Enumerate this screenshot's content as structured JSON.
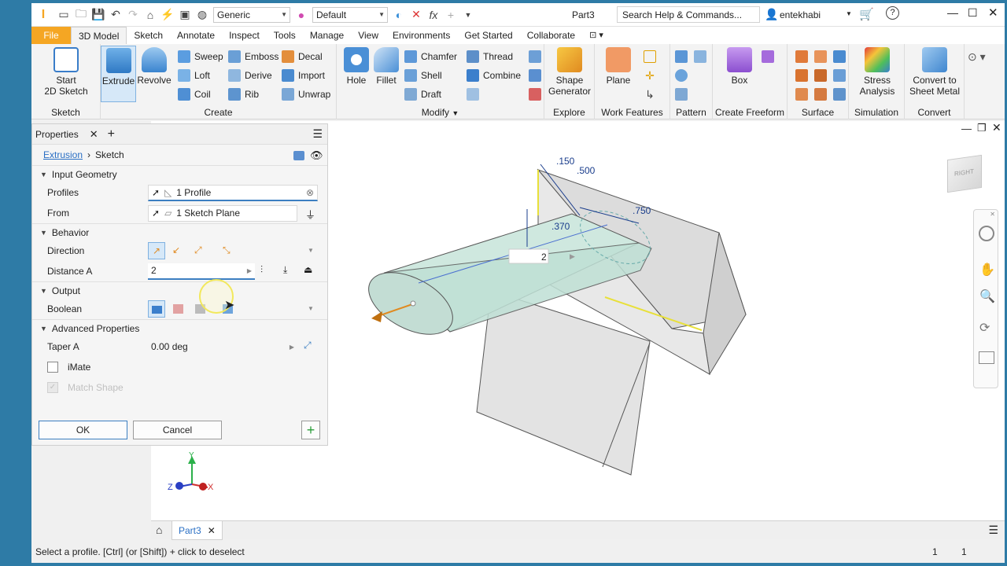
{
  "app": {
    "title": "Part3",
    "appearance": "Generic",
    "material": "Default",
    "search_placeholder": "Search Help & Commands...",
    "user": "entekhabi",
    "accent": "#f5a623"
  },
  "tabs": [
    "File",
    "3D Model",
    "Sketch",
    "Annotate",
    "Inspect",
    "Tools",
    "Manage",
    "View",
    "Environments",
    "Get Started",
    "Collaborate"
  ],
  "ribbon": {
    "sketch": {
      "label": "Sketch",
      "start_line1": "Start",
      "start_line2": "2D Sketch"
    },
    "create": {
      "label": "Create",
      "extrude": "Extrude",
      "revolve": "Revolve",
      "sweep": "Sweep",
      "emboss": "Emboss",
      "decal": "Decal",
      "loft": "Loft",
      "derive": "Derive",
      "import": "Import",
      "coil": "Coil",
      "rib": "Rib",
      "unwrap": "Unwrap"
    },
    "modify": {
      "label": "Modify",
      "hole": "Hole",
      "fillet": "Fillet",
      "chamfer": "Chamfer",
      "thread": "Thread",
      "shell": "Shell",
      "combine": "Combine",
      "draft": "Draft"
    },
    "explore": {
      "label": "Explore",
      "shape_line1": "Shape",
      "shape_line2": "Generator"
    },
    "work": {
      "label": "Work Features",
      "plane": "Plane"
    },
    "pattern": {
      "label": "Pattern"
    },
    "freeform": {
      "label": "Create Freeform",
      "box": "Box"
    },
    "surface": {
      "label": "Surface"
    },
    "simulation": {
      "label": "Simulation",
      "stress_line1": "Stress",
      "stress_line2": "Analysis"
    },
    "convert": {
      "label": "Convert",
      "line1": "Convert to",
      "line2": "Sheet Metal"
    }
  },
  "props": {
    "title": "Properties",
    "crumb_feature": "Extrusion",
    "crumb_sketch": "Sketch",
    "input_geometry": "Input Geometry",
    "profiles_label": "Profiles",
    "profiles_value": "1 Profile",
    "from_label": "From",
    "from_value": "1 Sketch Plane",
    "behavior": "Behavior",
    "direction_label": "Direction",
    "distance_label": "Distance A",
    "distance_value": "2",
    "output": "Output",
    "boolean_label": "Boolean",
    "advanced": "Advanced Properties",
    "taper_label": "Taper A",
    "taper_value": "0.00 deg",
    "imate": "iMate",
    "match_shape": "Match Shape",
    "ok": "OK",
    "cancel": "Cancel"
  },
  "viewport": {
    "dims": {
      "d150": ".150",
      "d500": ".500",
      "d750": ".750",
      "d370": ".370",
      "extent": "2"
    },
    "axes": {
      "x": "X",
      "y": "Y",
      "z": "Z"
    },
    "viewcube": "RIGHT"
  },
  "doc_tab": "Part3",
  "status": {
    "message": "Select a profile. [Ctrl] (or [Shift]) + click to deselect",
    "count1": "1",
    "count2": "1"
  }
}
